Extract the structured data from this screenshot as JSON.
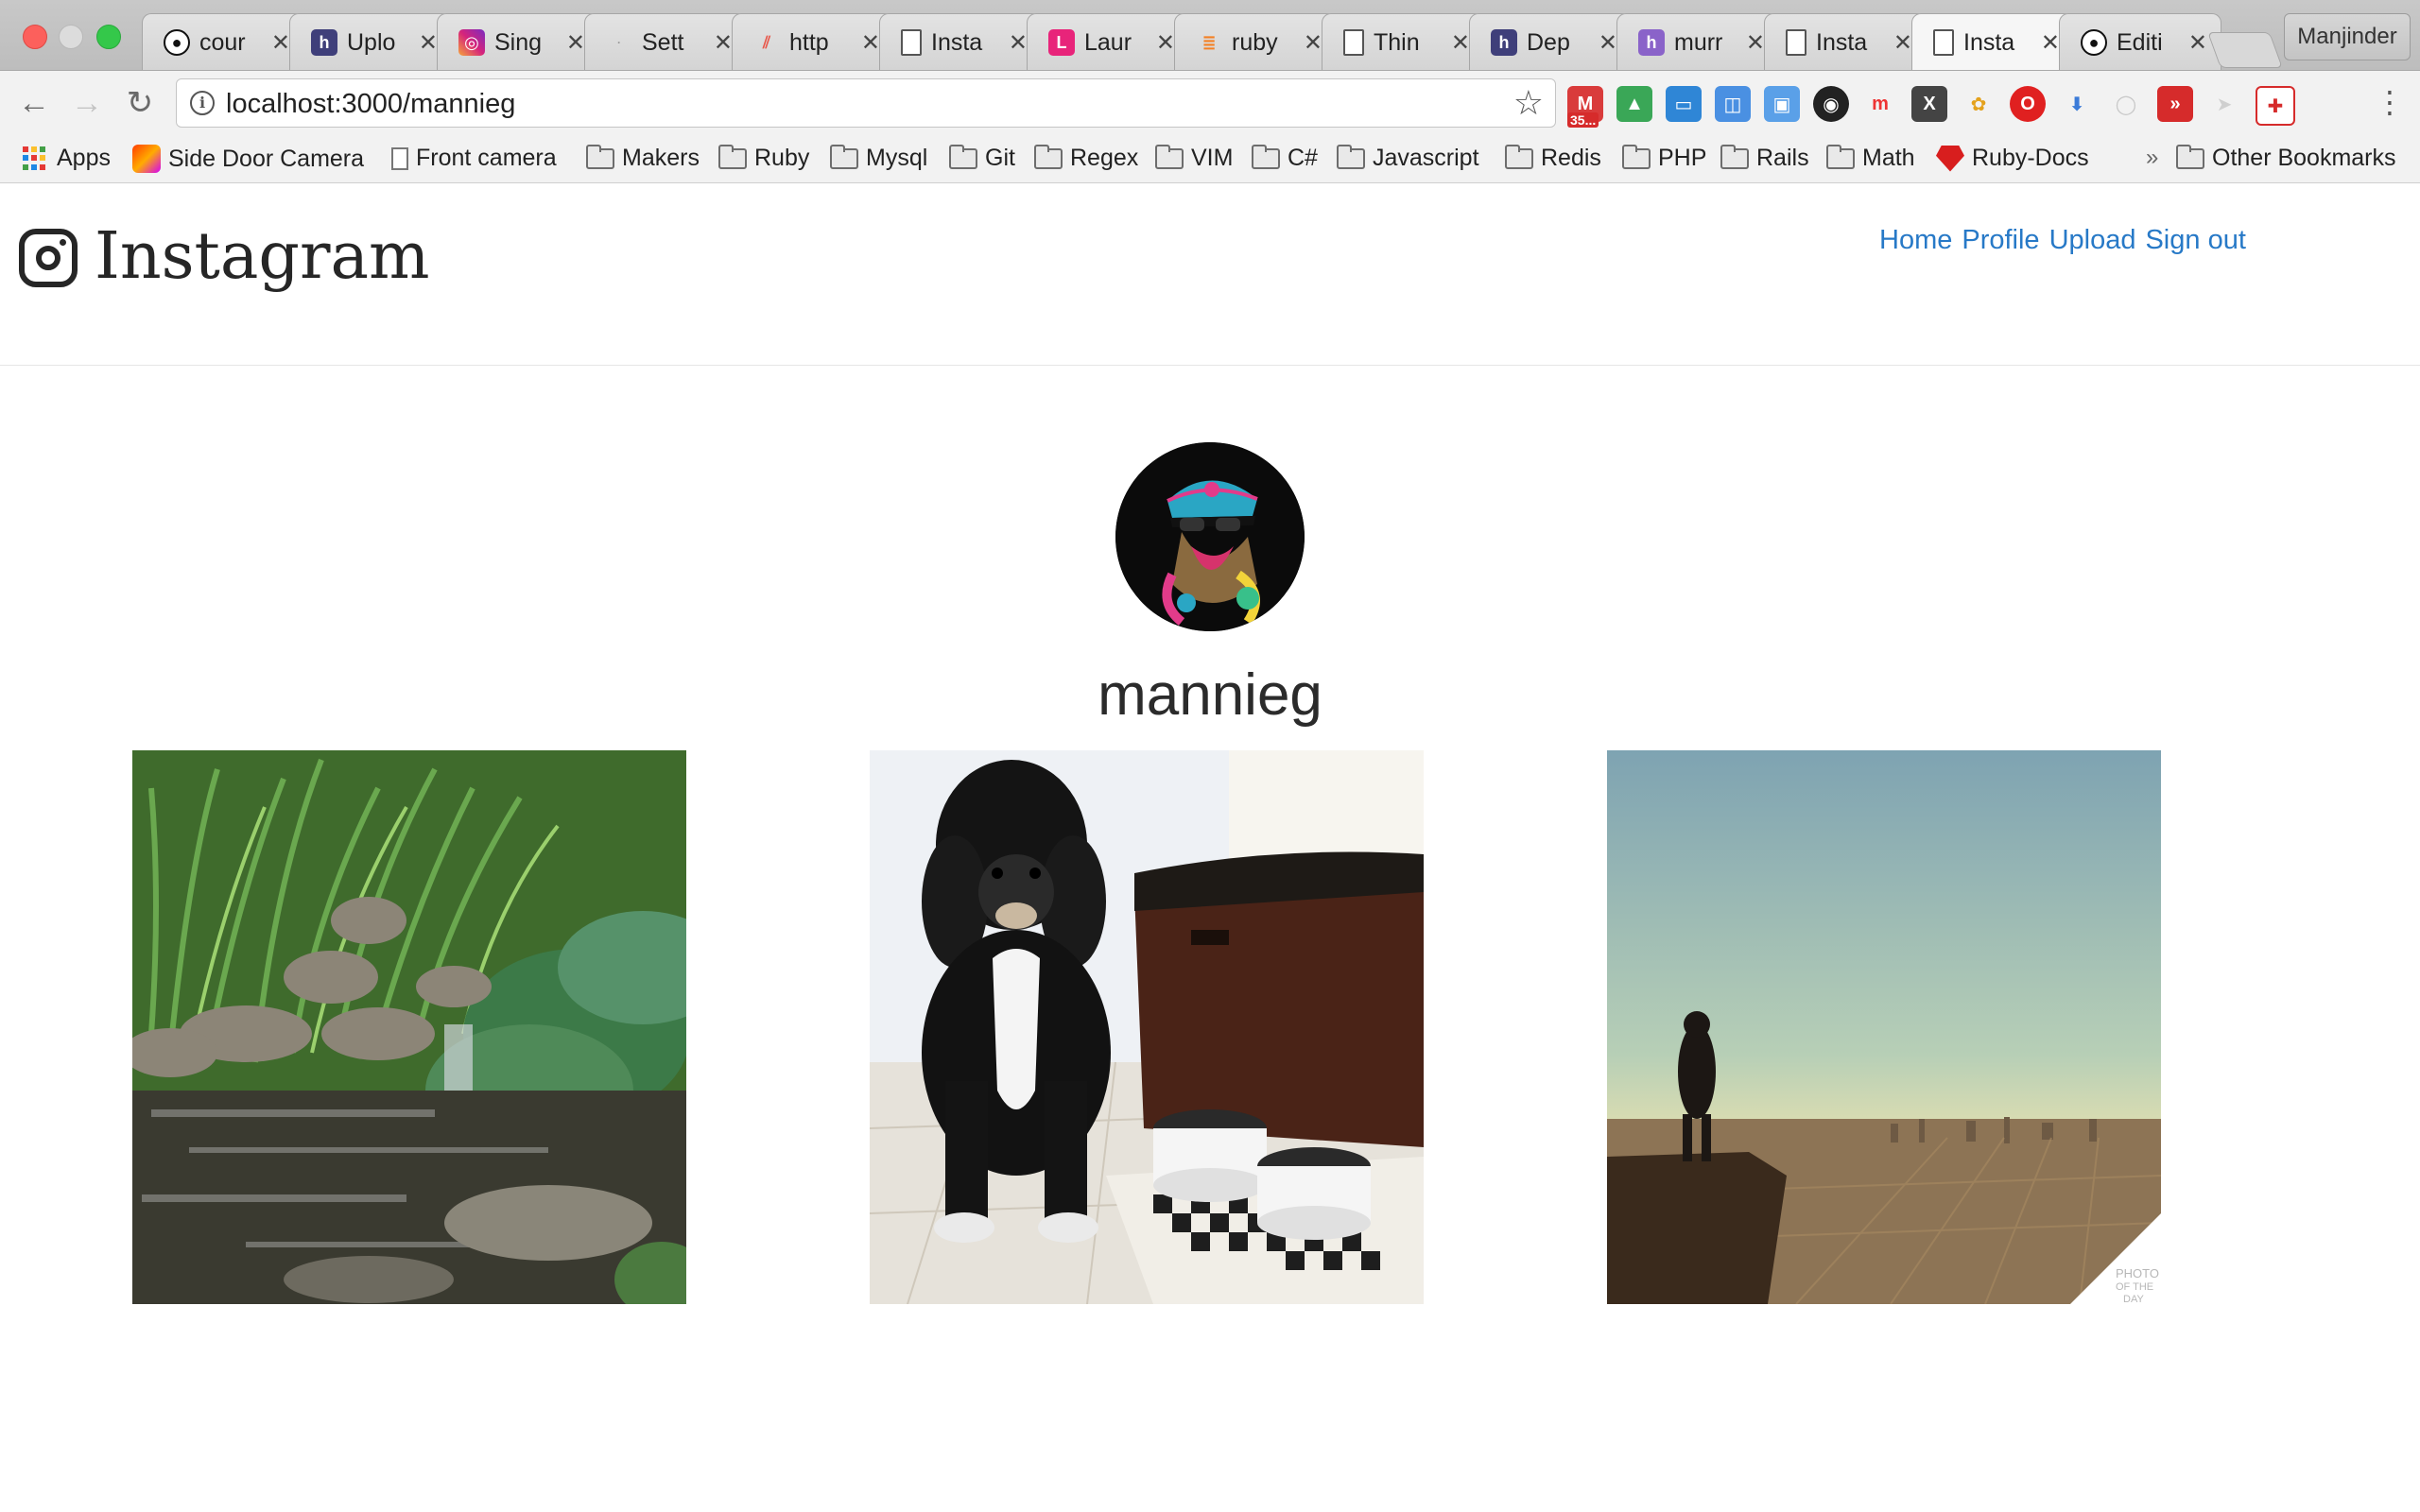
{
  "browser": {
    "tabs": [
      {
        "title": "cour",
        "icon": "github-icon"
      },
      {
        "title": "Uplo",
        "icon": "heroku-icon"
      },
      {
        "title": "Sing",
        "icon": "instagram-icon"
      },
      {
        "title": "Sett",
        "icon": "settings-favicon"
      },
      {
        "title": "http",
        "icon": "stripes-icon"
      },
      {
        "title": "Insta",
        "icon": "page-icon"
      },
      {
        "title": "Laur",
        "icon": "l-logo-icon"
      },
      {
        "title": "ruby",
        "icon": "stackoverflow-icon"
      },
      {
        "title": "Thin",
        "icon": "page-icon"
      },
      {
        "title": "Dep",
        "icon": "heroku-icon"
      },
      {
        "title": "murr",
        "icon": "heroku-purple-icon"
      },
      {
        "title": "Insta",
        "icon": "page-icon"
      },
      {
        "title": "Insta",
        "icon": "page-icon"
      },
      {
        "title": "Editi",
        "icon": "github-icon"
      }
    ],
    "profile_name": "Manjinder",
    "url": "localhost:3000/mannieg",
    "extensions_badge": "35...",
    "bookmarks": [
      {
        "label": "Apps",
        "type": "apps"
      },
      {
        "label": "Side Door Camera",
        "type": "site"
      },
      {
        "label": "Front camera",
        "type": "page"
      },
      {
        "label": "Makers",
        "type": "folder"
      },
      {
        "label": "Ruby",
        "type": "folder"
      },
      {
        "label": "Mysql",
        "type": "folder"
      },
      {
        "label": "Git",
        "type": "folder"
      },
      {
        "label": "Regex",
        "type": "folder"
      },
      {
        "label": "VIM",
        "type": "folder"
      },
      {
        "label": "C#",
        "type": "folder"
      },
      {
        "label": "Javascript",
        "type": "folder"
      },
      {
        "label": "Redis",
        "type": "folder"
      },
      {
        "label": "PHP",
        "type": "folder"
      },
      {
        "label": "Rails",
        "type": "folder"
      },
      {
        "label": "Math",
        "type": "folder"
      },
      {
        "label": "Ruby-Docs",
        "type": "site"
      }
    ],
    "bookmarks_overflow": "»",
    "other_bookmarks": "Other Bookmarks"
  },
  "page": {
    "brand": "Instagram",
    "nav": [
      "Home",
      "Profile",
      "Upload",
      "Sign out"
    ],
    "username": "mannieg",
    "photos": [
      {
        "subject": "garden pond with stream and hostas"
      },
      {
        "subject": "black and white puppy sitting by checkered bowls"
      },
      {
        "subject": "person standing on hill overlooking city"
      }
    ],
    "photo_watermark": [
      "PHOTO",
      "OF THE",
      "DAY"
    ]
  },
  "colors": {
    "link": "#2779c7",
    "text": "#262626"
  }
}
